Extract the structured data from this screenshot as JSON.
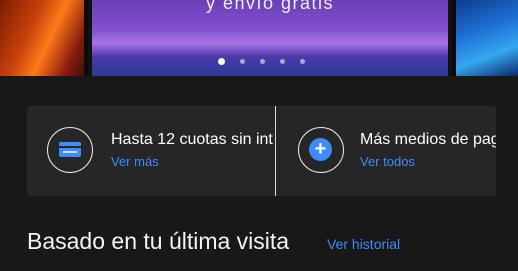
{
  "banner": {
    "text": "y envío gratis",
    "dots_total": 5,
    "active_dot": 1
  },
  "payment": {
    "items": [
      {
        "title": "Hasta 12 cuotas sin int",
        "link": "Ver más",
        "icon": "credit-card-icon"
      },
      {
        "title": "Más medios de pago",
        "link": "Ver todos",
        "icon": "plus-circle-icon"
      }
    ]
  },
  "section": {
    "title": "Basado en tu última visita",
    "link": "Ver historial"
  },
  "colors": {
    "accent": "#3d8bfd",
    "background": "#181818",
    "card": "#262626"
  }
}
